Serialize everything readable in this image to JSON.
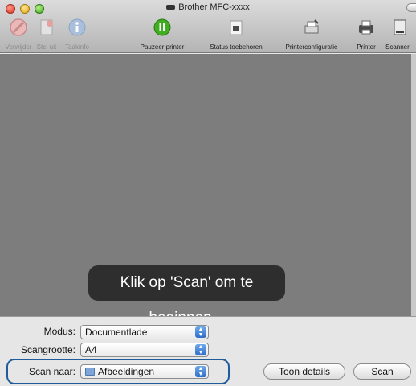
{
  "window": {
    "title": "Brother MFC-xxxx"
  },
  "toolbar": {
    "items": [
      {
        "label": "Verwijder",
        "icon": "delete-icon",
        "enabled": false
      },
      {
        "label": "Stel uit",
        "icon": "hold-icon",
        "enabled": false
      },
      {
        "label": "Taakinfo",
        "icon": "info-icon",
        "enabled": false
      },
      {
        "label": "Pauzeer printer",
        "icon": "pause-icon",
        "enabled": true
      },
      {
        "label": "Status toebehoren",
        "icon": "supply-status-icon",
        "enabled": true
      },
      {
        "label": "Printerconfiguratie",
        "icon": "printer-setup-icon",
        "enabled": true
      },
      {
        "label": "Printer",
        "icon": "printer-icon",
        "enabled": true
      },
      {
        "label": "Scanner",
        "icon": "scanner-icon",
        "enabled": true
      }
    ]
  },
  "preview": {
    "hud_text": "Klik op 'Scan' om te beginnen..."
  },
  "settings": {
    "mode": {
      "label": "Modus:",
      "value": "Documentlade"
    },
    "scan_size": {
      "label": "Scangrootte:",
      "value": "A4"
    },
    "scan_to": {
      "label": "Scan naar:",
      "value": "Afbeeldingen"
    },
    "show_details_label": "Toon details",
    "scan_label": "Scan"
  },
  "colors": {
    "preview_bg": "#7d7d7d",
    "highlight": "#1f5c9c",
    "pause_green": "#3fae20"
  }
}
